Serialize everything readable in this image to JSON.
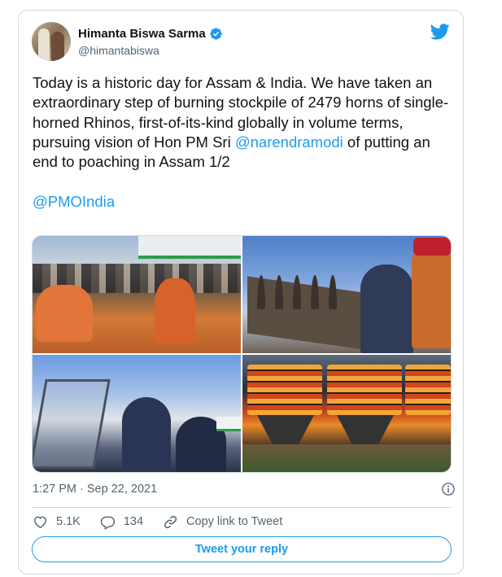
{
  "author": {
    "display_name": "Himanta Biswa Sarma",
    "handle": "@himantabiswa",
    "verified": true,
    "avatar_icon": "profile-photo"
  },
  "tweet": {
    "text_before_mention": "Today is a historic day for Assam & India. We have taken an extraordinary step of burning stockpile of 2479 horns of single-horned Rhinos, first-of-its-kind globally in volume terms, pursuing vision of Hon PM Sri ",
    "mention_1": "@narendramodi",
    "text_after_mention": " of putting an end to poaching in Assam 1/2",
    "mention_2": "@PMOIndia"
  },
  "media": {
    "photo_count": 4
  },
  "timestamp": "1:27 PM · Sep 22, 2021",
  "actions": {
    "like_count": "5.1K",
    "reply_count": "134",
    "copy_link_label": "Copy link to Tweet"
  },
  "reply_button_label": "Tweet your reply",
  "colors": {
    "accent": "#1d9bf0",
    "text_primary": "#0f1419",
    "text_secondary": "#536471",
    "border": "#cfd9de"
  },
  "icons": [
    "twitter-bird-icon",
    "verified-badge-icon",
    "info-icon",
    "heart-icon",
    "reply-icon",
    "link-icon"
  ]
}
